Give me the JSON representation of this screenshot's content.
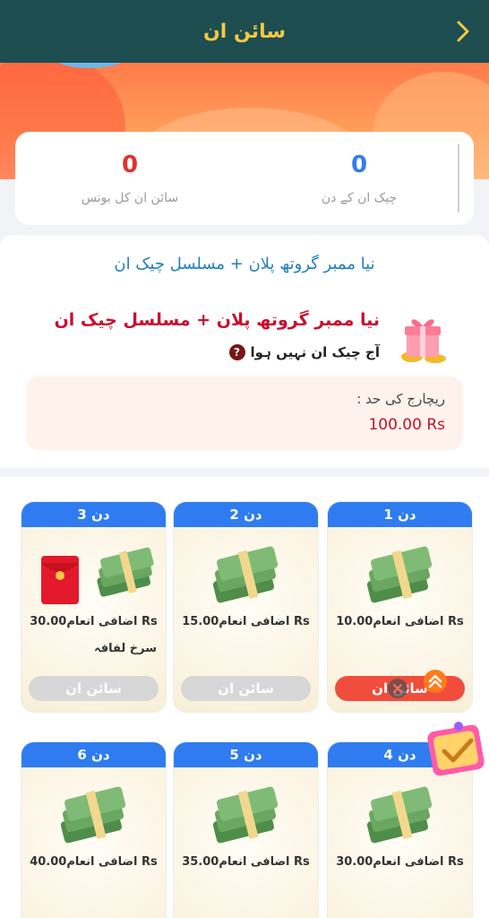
{
  "header": {
    "title": "سائن ان"
  },
  "stats": {
    "total_bonus_value": "0",
    "total_bonus_label": "سائن ان کل بونس",
    "checkin_days_value": "0",
    "checkin_days_label": "چیک ان کے دن"
  },
  "info": {
    "link_text": "نیا ممبر گروتھ پلان + مسلسل چیک ان",
    "plan_title": "نیا ممبر گروتھ پلان + مسلسل چیک ان",
    "plan_status": "آج چیک ان نہیں ہوا",
    "limit_label": "ریچارج کی حد :",
    "limit_value": "100.00 Rs"
  },
  "days": [
    {
      "label": "دن 1",
      "reward": "اضافی انعام10.00 Rs",
      "button": "سائن ان",
      "active": true
    },
    {
      "label": "دن 2",
      "reward": "اضافی انعام15.00 Rs",
      "button": "سائن ان",
      "active": false
    },
    {
      "label": "دن 3",
      "reward": "اضافی انعام30.00 Rs",
      "reward_extra": "سرخ لفافہ",
      "button": "سائن ان",
      "active": false
    },
    {
      "label": "دن 4",
      "reward": "اضافی انعام30.00 Rs"
    },
    {
      "label": "دن 5",
      "reward": "اضافی انعام35.00 Rs"
    },
    {
      "label": "دن 6",
      "reward": "اضافی انعام40.00 Rs"
    }
  ],
  "colors": {
    "header_bg": "#1d4d4f",
    "header_title": "#f5c842",
    "stat_bonus": "#e2312d",
    "stat_days": "#2f7cf1",
    "day_header": "#2f7cf1",
    "active_button": "#f04d3d",
    "accent_red": "#c8102e"
  },
  "icons": [
    "chevron-right-icon",
    "gift-box-icon",
    "question-icon",
    "money-stack-icon",
    "red-envelope-icon",
    "arrow-up-icon",
    "close-icon",
    "trophy-badge-icon"
  ]
}
